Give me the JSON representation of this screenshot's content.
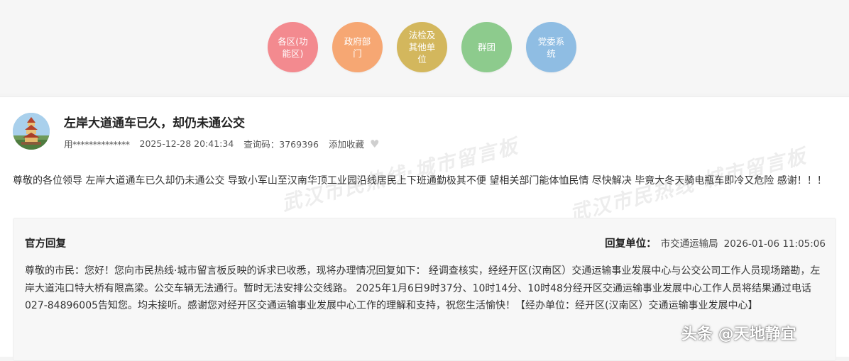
{
  "nav": {
    "items": [
      {
        "label": "各区(功能区)",
        "color": "#f38a8f"
      },
      {
        "label": "政府部门",
        "color": "#f6a773"
      },
      {
        "label": "法检及其他单位",
        "color": "#d3b75d"
      },
      {
        "label": "群团",
        "color": "#8dcb8d"
      },
      {
        "label": "党委系统",
        "color": "#8fbde3"
      }
    ]
  },
  "post": {
    "title": "左岸大道通车已久，却仍未通公交",
    "user": "用**************",
    "datetime": "2025-12-28 20:41:34",
    "query_code": "查询码：3769396",
    "favorite_label": "添加收藏",
    "content": "尊敬的各位领导 左岸大道通车已久却仍未通公交 导致小军山至汉南华顶工业园沿线居民上下班通勤极其不便 望相关部门能体恤民情 尽快解决 毕竟大冬天骑电瓶车即冷又危险 感谢！！！"
  },
  "reply": {
    "title": "官方回复",
    "unit_label": "回复单位：",
    "unit": "市交通运输局",
    "datetime": "2026-01-06 11:05:06",
    "body": "尊敬的市民：您好！您向市民热线·城市留言板反映的诉求已收悉，现将办理情况回复如下： 经调查核实，经经开区(汉南区）交通运输事业发展中心与公交公司工作人员现场踏勘，左岸大道沌口特大桥有限高梁。公交车辆无法通行。暂时无法安排公交线路。 2025年1月6日9时37分、10时14分、10时48分经开区交通运输事业发展中心工作人员将结果通过电话027-84896005告知您。均未接听。感谢您对经开区交通运输事业发展中心工作的理解和支持，祝您生活愉快！【经办单位：经开区(汉南区）交通运输事业发展中心】"
  },
  "watermark": "武汉市民热线·城市留言板",
  "source_tag": "头条 @天地静宜"
}
